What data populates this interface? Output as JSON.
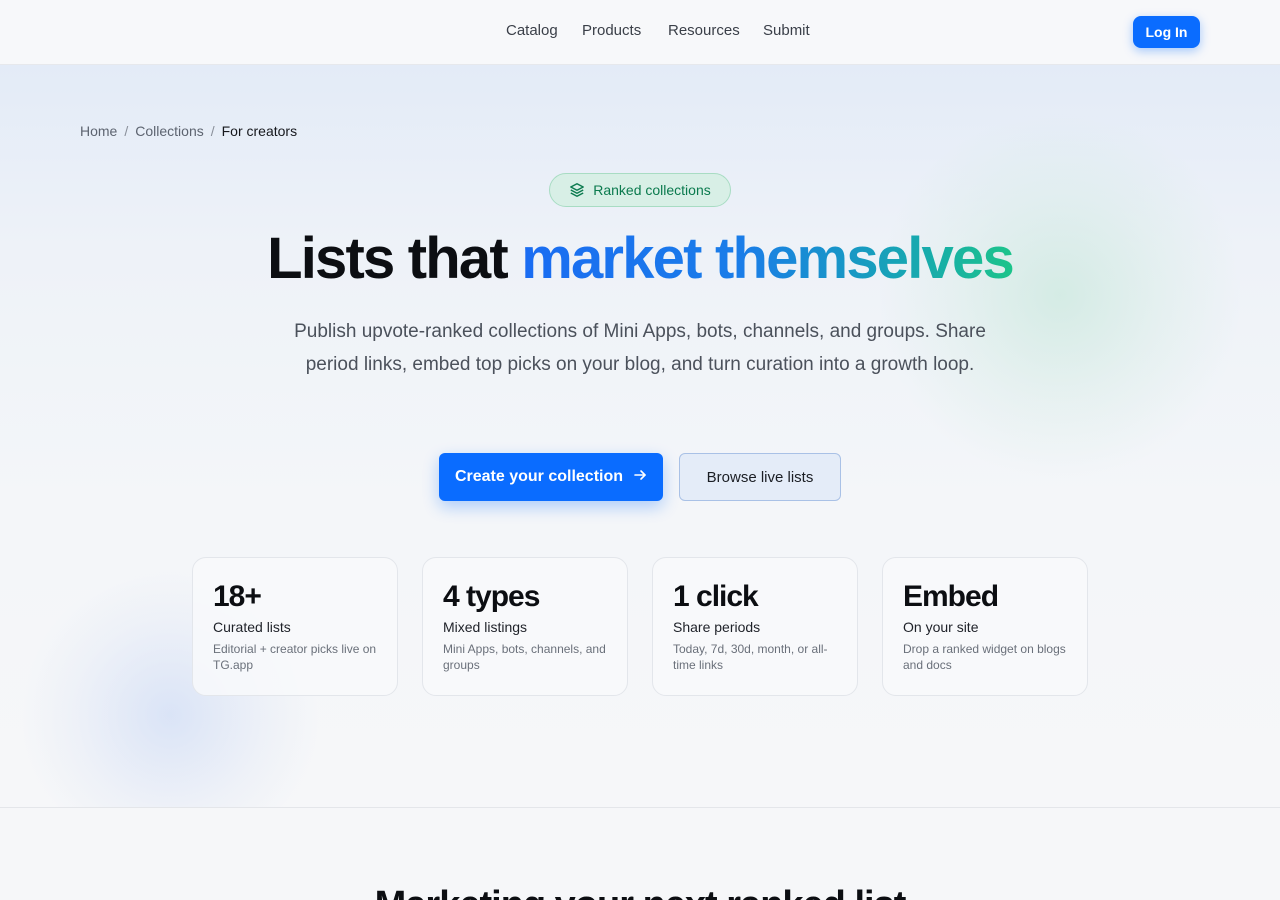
{
  "nav": {
    "items": [
      {
        "label": "Catalog"
      },
      {
        "label": "Products"
      },
      {
        "label": "Resources"
      },
      {
        "label": "Submit"
      }
    ],
    "login_label": "Log In"
  },
  "breadcrumb": {
    "items": [
      "Home",
      "Collections"
    ],
    "separator": "/",
    "current": "For creators"
  },
  "hero": {
    "badge": {
      "icon": "layers-icon",
      "label": "Ranked collections"
    },
    "headline_plain": "Lists that",
    "headline_accent": "market themselves",
    "subtext": "Publish upvote-ranked collections of Mini Apps, bots, channels, and groups. Share period links, embed top picks on your blog, and turn curation into a growth loop.",
    "primary_cta": "Create your collection",
    "primary_cta_icon": "arrow-right-icon",
    "secondary_cta": "Browse live lists"
  },
  "stats": [
    {
      "value": "18+",
      "title": "Curated lists",
      "desc": "Editorial + creator picks live on TG.app"
    },
    {
      "value": "4 types",
      "title": "Mixed listings",
      "desc": "Mini Apps, bots, channels, and groups"
    },
    {
      "value": "1 click",
      "title": "Share periods",
      "desc": "Today, 7d, 30d, month, or all-time links"
    },
    {
      "value": "Embed",
      "title": "On your site",
      "desc": "Drop a ranked widget on blogs and docs"
    }
  ],
  "next_section": {
    "heading": "Marketing your next ranked list"
  },
  "colors": {
    "accent": "#0a6cff",
    "badge_bg": "#d8efe6",
    "badge_text": "#0b7a4e",
    "gradient_start": "#1a6cf2",
    "gradient_end": "#1cc48a"
  }
}
